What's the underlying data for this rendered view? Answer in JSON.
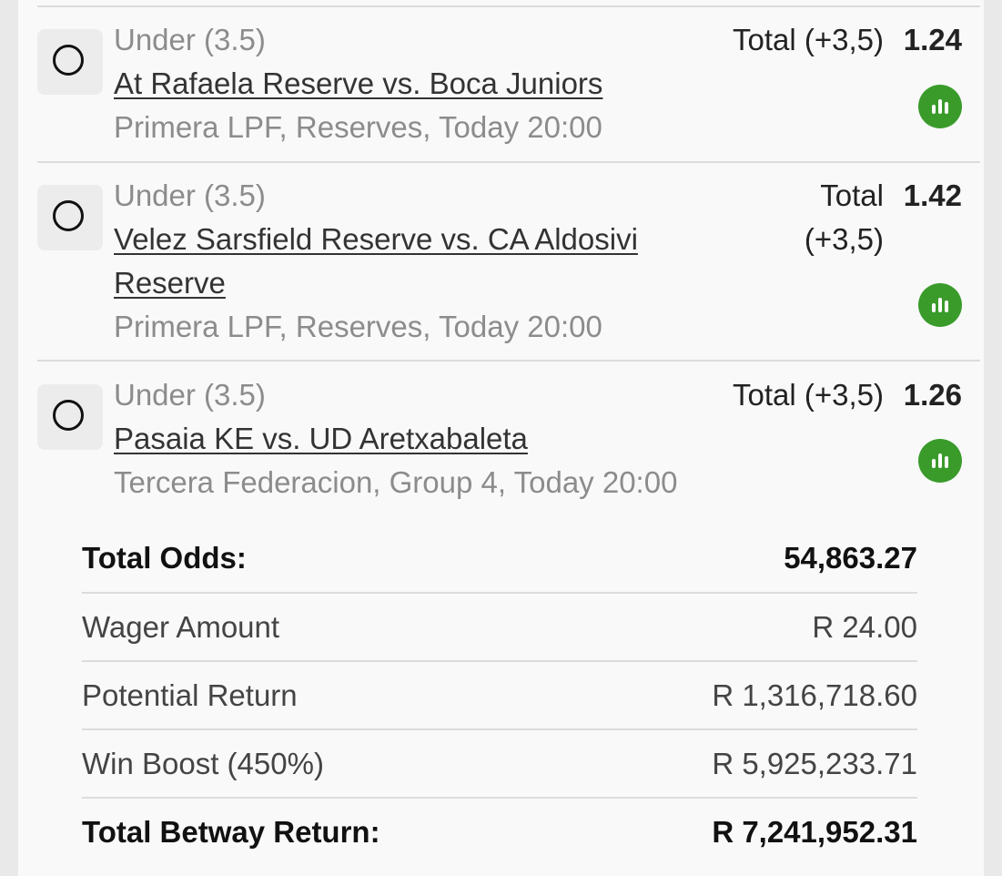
{
  "legs": [
    {
      "market": "Under (3.5)",
      "event": "At Rafaela Reserve vs. Boca Juniors",
      "event_line2": "",
      "league": "Primera LPF, Reserves, Today 20:00",
      "selection": "Total (+3,5)",
      "selection_line2": "",
      "odds": "1.24",
      "stats_icon": "bar-chart-icon"
    },
    {
      "market": "Under (3.5)",
      "event": "Velez Sarsfield Reserve vs. CA Aldosivi",
      "event_line2": "Reserve",
      "league": "Primera LPF, Reserves, Today 20:00",
      "selection": "Total",
      "selection_line2": "(+3,5)",
      "odds": "1.42",
      "stats_icon": "bar-chart-icon"
    },
    {
      "market": "Under (3.5)",
      "event": "Pasaia KE vs. UD Aretxabaleta",
      "event_line2": "",
      "league": "Tercera Federacion, Group 4, Today 20:00",
      "selection": "Total (+3,5)",
      "selection_line2": "",
      "odds": "1.26",
      "stats_icon": "bar-chart-icon"
    }
  ],
  "summary": {
    "total_odds_label": "Total Odds:",
    "total_odds_value": "54,863.27",
    "wager_label": "Wager Amount",
    "wager_value": "R 24.00",
    "potential_label": "Potential Return",
    "potential_value": "R 1,316,718.60",
    "boost_label": "Win Boost (450%)",
    "boost_value": "R 5,925,233.71",
    "total_return_label": "Total Betway Return:",
    "total_return_value": "R 7,241,952.31"
  },
  "colors": {
    "stats_green": "#3a9b2b",
    "muted_text": "#8c8c8c",
    "divider": "#dcdcdc"
  }
}
